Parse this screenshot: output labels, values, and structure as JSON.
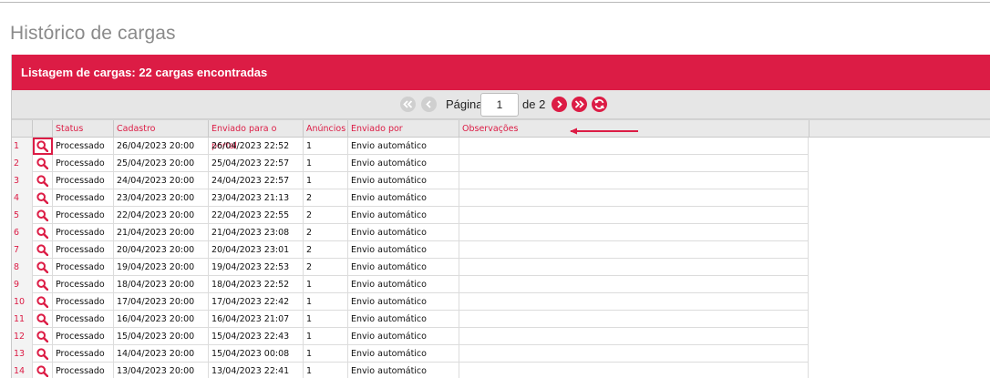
{
  "dialog": {
    "title": "Histórico de cargas"
  },
  "panel": {
    "header": "Listagem de cargas: 22 cargas encontradas"
  },
  "pager": {
    "page_label": "Página",
    "page_value": "1",
    "of_label": "de 2"
  },
  "columns": [
    "",
    "",
    "Status",
    "Cadastro",
    "Enviado para o portal",
    "Anúncios",
    "Enviado por",
    "Observações"
  ],
  "rows": [
    {
      "n": "1",
      "status": "Processado",
      "cadastro": "26/04/2023 20:00",
      "enviado_portal": "26/04/2023 22:52",
      "anuncios": "1",
      "enviado_por": "Envio automático"
    },
    {
      "n": "2",
      "status": "Processado",
      "cadastro": "25/04/2023 20:00",
      "enviado_portal": "25/04/2023 22:57",
      "anuncios": "1",
      "enviado_por": "Envio automático"
    },
    {
      "n": "3",
      "status": "Processado",
      "cadastro": "24/04/2023 20:00",
      "enviado_portal": "24/04/2023 22:57",
      "anuncios": "1",
      "enviado_por": "Envio automático"
    },
    {
      "n": "4",
      "status": "Processado",
      "cadastro": "23/04/2023 20:00",
      "enviado_portal": "23/04/2023 21:13",
      "anuncios": "2",
      "enviado_por": "Envio automático"
    },
    {
      "n": "5",
      "status": "Processado",
      "cadastro": "22/04/2023 20:00",
      "enviado_portal": "22/04/2023 22:55",
      "anuncios": "2",
      "enviado_por": "Envio automático"
    },
    {
      "n": "6",
      "status": "Processado",
      "cadastro": "21/04/2023 20:00",
      "enviado_portal": "21/04/2023 23:08",
      "anuncios": "2",
      "enviado_por": "Envio automático"
    },
    {
      "n": "7",
      "status": "Processado",
      "cadastro": "20/04/2023 20:00",
      "enviado_portal": "20/04/2023 23:01",
      "anuncios": "2",
      "enviado_por": "Envio automático"
    },
    {
      "n": "8",
      "status": "Processado",
      "cadastro": "19/04/2023 20:00",
      "enviado_portal": "19/04/2023 22:53",
      "anuncios": "2",
      "enviado_por": "Envio automático"
    },
    {
      "n": "9",
      "status": "Processado",
      "cadastro": "18/04/2023 20:00",
      "enviado_portal": "18/04/2023 22:52",
      "anuncios": "1",
      "enviado_por": "Envio automático"
    },
    {
      "n": "10",
      "status": "Processado",
      "cadastro": "17/04/2023 20:00",
      "enviado_portal": "17/04/2023 22:42",
      "anuncios": "1",
      "enviado_por": "Envio automático"
    },
    {
      "n": "11",
      "status": "Processado",
      "cadastro": "16/04/2023 20:00",
      "enviado_portal": "16/04/2023 21:07",
      "anuncios": "1",
      "enviado_por": "Envio automático"
    },
    {
      "n": "12",
      "status": "Processado",
      "cadastro": "15/04/2023 20:00",
      "enviado_portal": "15/04/2023 22:43",
      "anuncios": "1",
      "enviado_por": "Envio automático"
    },
    {
      "n": "13",
      "status": "Processado",
      "cadastro": "14/04/2023 20:00",
      "enviado_portal": "15/04/2023 00:08",
      "anuncios": "1",
      "enviado_por": "Envio automático"
    },
    {
      "n": "14",
      "status": "Processado",
      "cadastro": "13/04/2023 20:00",
      "enviado_portal": "13/04/2023 22:41",
      "anuncios": "1",
      "enviado_por": "Envio automático"
    }
  ],
  "icons": {
    "view": "search-icon",
    "first": "double-chevron-left-icon",
    "prev": "chevron-left-icon",
    "next": "chevron-right-icon",
    "last": "double-chevron-right-icon",
    "refresh": "refresh-icon"
  },
  "colors": {
    "accent": "#dc1c45",
    "header_bg": "#e9e9e9"
  }
}
